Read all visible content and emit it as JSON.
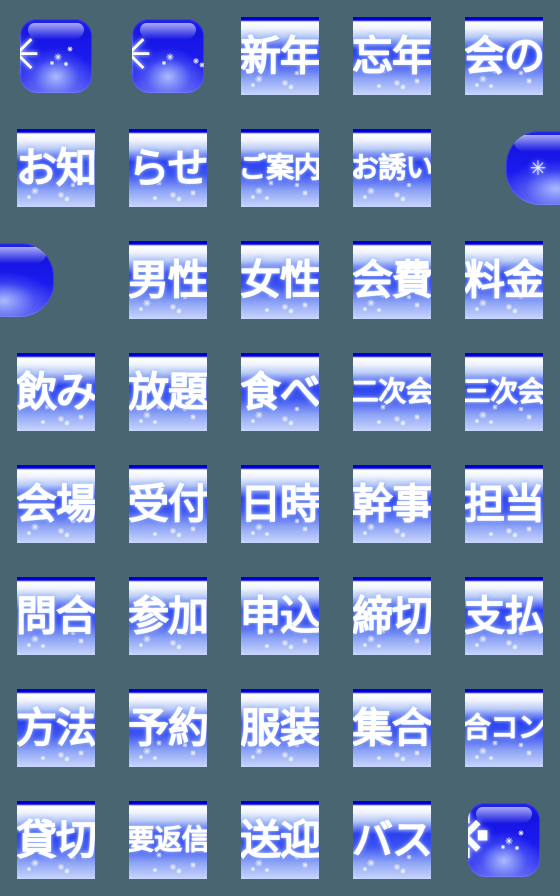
{
  "sheet": {
    "title": "Japanese party-invitation emoji sheet",
    "background_color": "#4a6572",
    "columns": 5,
    "rows": 8,
    "tile_accent_color": "#1414e2",
    "tile_text_color": "#ffffff"
  },
  "tiles": [
    {
      "id": "r1c1",
      "kind": "icon",
      "text": "✳",
      "icon": "snowflake-icon"
    },
    {
      "id": "r1c2",
      "kind": "icon",
      "text": "✳",
      "icon": "snowflake-icon"
    },
    {
      "id": "r1c3",
      "kind": "text",
      "text": "新年"
    },
    {
      "id": "r1c4",
      "kind": "text",
      "text": "忘年"
    },
    {
      "id": "r1c5",
      "kind": "text",
      "text": "会の"
    },
    {
      "id": "r2c1",
      "kind": "text",
      "text": "お知"
    },
    {
      "id": "r2c2",
      "kind": "text",
      "text": "らせ"
    },
    {
      "id": "r2c3",
      "kind": "text",
      "text": "ご案内"
    },
    {
      "id": "r2c4",
      "kind": "text",
      "text": "お誘い"
    },
    {
      "id": "r2c5",
      "kind": "half-right",
      "text": "✳",
      "icon": "snowflake-icon"
    },
    {
      "id": "r3c1",
      "kind": "half-left",
      "text": "✳",
      "icon": "snowflake-icon"
    },
    {
      "id": "r3c2",
      "kind": "text",
      "text": "男性"
    },
    {
      "id": "r3c3",
      "kind": "text",
      "text": "女性"
    },
    {
      "id": "r3c4",
      "kind": "text",
      "text": "会費"
    },
    {
      "id": "r3c5",
      "kind": "text",
      "text": "料金"
    },
    {
      "id": "r4c1",
      "kind": "text",
      "text": "飲み"
    },
    {
      "id": "r4c2",
      "kind": "text",
      "text": "放題"
    },
    {
      "id": "r4c3",
      "kind": "text",
      "text": "食べ"
    },
    {
      "id": "r4c4",
      "kind": "text",
      "text": "二次会"
    },
    {
      "id": "r4c5",
      "kind": "text",
      "text": "三次会"
    },
    {
      "id": "r5c1",
      "kind": "text",
      "text": "会場"
    },
    {
      "id": "r5c2",
      "kind": "text",
      "text": "受付"
    },
    {
      "id": "r5c3",
      "kind": "text",
      "text": "日時"
    },
    {
      "id": "r5c4",
      "kind": "text",
      "text": "幹事"
    },
    {
      "id": "r5c5",
      "kind": "text",
      "text": "担当"
    },
    {
      "id": "r6c1",
      "kind": "text",
      "text": "問合"
    },
    {
      "id": "r6c2",
      "kind": "text",
      "text": "参加"
    },
    {
      "id": "r6c3",
      "kind": "text",
      "text": "申込"
    },
    {
      "id": "r6c4",
      "kind": "text",
      "text": "締切"
    },
    {
      "id": "r6c5",
      "kind": "text",
      "text": "支払"
    },
    {
      "id": "r7c1",
      "kind": "text",
      "text": "方法"
    },
    {
      "id": "r7c2",
      "kind": "text",
      "text": "予約"
    },
    {
      "id": "r7c3",
      "kind": "text",
      "text": "服装"
    },
    {
      "id": "r7c4",
      "kind": "text",
      "text": "集合"
    },
    {
      "id": "r7c5",
      "kind": "text",
      "text": "合コン"
    },
    {
      "id": "r8c1",
      "kind": "text",
      "text": "貸切"
    },
    {
      "id": "r8c2",
      "kind": "text",
      "text": "要返信"
    },
    {
      "id": "r8c3",
      "kind": "text",
      "text": "送迎"
    },
    {
      "id": "r8c4",
      "kind": "text",
      "text": "バス"
    },
    {
      "id": "r8c5",
      "kind": "icon",
      "text": "※",
      "icon": "kome-mark-icon"
    }
  ]
}
